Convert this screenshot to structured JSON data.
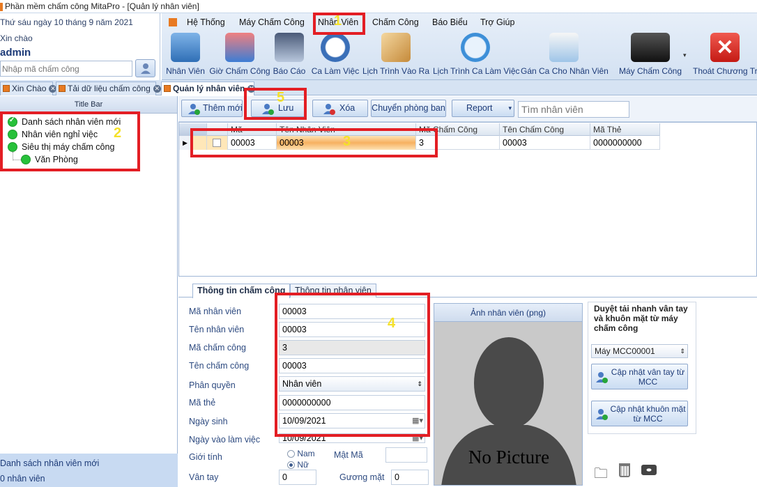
{
  "window": {
    "title": "Phần mềm chấm công MitaPro - [Quản lý nhân viên]"
  },
  "user_panel": {
    "date": "Thứ sáu ngày 10 tháng 9 năm 2021",
    "greeting": "Xin chào",
    "username": "admin",
    "code_placeholder": "Nhập mã chấm công"
  },
  "menu": [
    "Hệ Thống",
    "Máy Chấm Công",
    "Nhân Viên",
    "Chấm Công",
    "Báo Biểu",
    "Trợ Giúp"
  ],
  "ribbon_buttons": [
    {
      "label": "Nhân Viên",
      "icon": "employee-icon"
    },
    {
      "label": "Giờ Chấm Công",
      "icon": "attendance-time-icon"
    },
    {
      "label": "Báo Cáo",
      "icon": "report-icon"
    },
    {
      "label": "Ca Làm Việc",
      "icon": "alarm-clock-icon"
    },
    {
      "label": "Lịch Trình Vào Ra",
      "icon": "schedule-icon"
    },
    {
      "label": "Lịch Trình Ca Làm Việc",
      "icon": "calendar-icon"
    },
    {
      "label": "Gán Ca Cho Nhân Viên",
      "icon": "assign-shift-icon"
    },
    {
      "label": "Máy Chấm Công",
      "icon": "fingerprint-machine-icon"
    },
    {
      "label": "Thoát Chương Trình",
      "icon": "exit-icon"
    }
  ],
  "doc_tabs": [
    "Xin Chào",
    "Tải dữ liệu chấm công",
    "Quản lý nhân viên"
  ],
  "left_panel": {
    "header": "Title Bar",
    "tree": [
      "Danh sách nhân viên mới",
      "Nhân viên nghỉ việc",
      "Siêu thị máy chấm công",
      "Văn Phòng"
    ],
    "footer": [
      "Danh sách nhân viên mới",
      "0 nhân viên"
    ]
  },
  "toolbar": {
    "add": "Thêm mới",
    "save": "Lưu",
    "delete": "Xóa",
    "transfer": "Chuyển phòng ban",
    "report": "Report",
    "search_placeholder": "Tìm nhân viên"
  },
  "grid": {
    "columns": [
      "Mã",
      "Tên Nhân Viên",
      "Mã Chấm Công",
      "Tên Chấm Công",
      "Mã Thẻ"
    ],
    "rows": [
      [
        "00003",
        "00003",
        "3",
        "00003",
        "0000000000"
      ]
    ]
  },
  "detail_tabs": [
    "Thông tin chấm công",
    "Thông tin nhân viên"
  ],
  "form": {
    "labels": {
      "employee_code": "Mã nhân viên",
      "employee_name": "Tên nhân viên",
      "attendance_code": "Mã chấm công",
      "attendance_name": "Tên chấm công",
      "role": "Phân quyền",
      "card_code": "Mã thẻ",
      "birthday": "Ngày sinh",
      "start_date": "Ngày vào làm việc",
      "gender": "Giới tính",
      "password": "Mật Mã",
      "fingerprint": "Vân tay",
      "face": "Gương mặt"
    },
    "values": {
      "employee_code": "00003",
      "employee_name": "00003",
      "attendance_code": "3",
      "attendance_name": "00003",
      "role": "Nhân viên",
      "card_code": "0000000000",
      "birthday": "10/09/2021",
      "start_date": "10/09/2021",
      "gender_male": "Nam",
      "gender_female": "Nữ",
      "fingerprint": "0",
      "face": "0"
    }
  },
  "photo": {
    "title": "Ảnh nhân viên (png)",
    "placeholder": "No Picture"
  },
  "sync_panel": {
    "title": "Duyệt tải nhanh vân tay và khuôn mặt từ máy chấm công",
    "machine": "Máy MCC00001",
    "update_finger": "Cập nhật vân tay từ MCC",
    "update_face": "Cập nhật khuôn mặt từ MCC"
  },
  "annotations": [
    "1",
    "2",
    "3",
    "4",
    "5"
  ]
}
